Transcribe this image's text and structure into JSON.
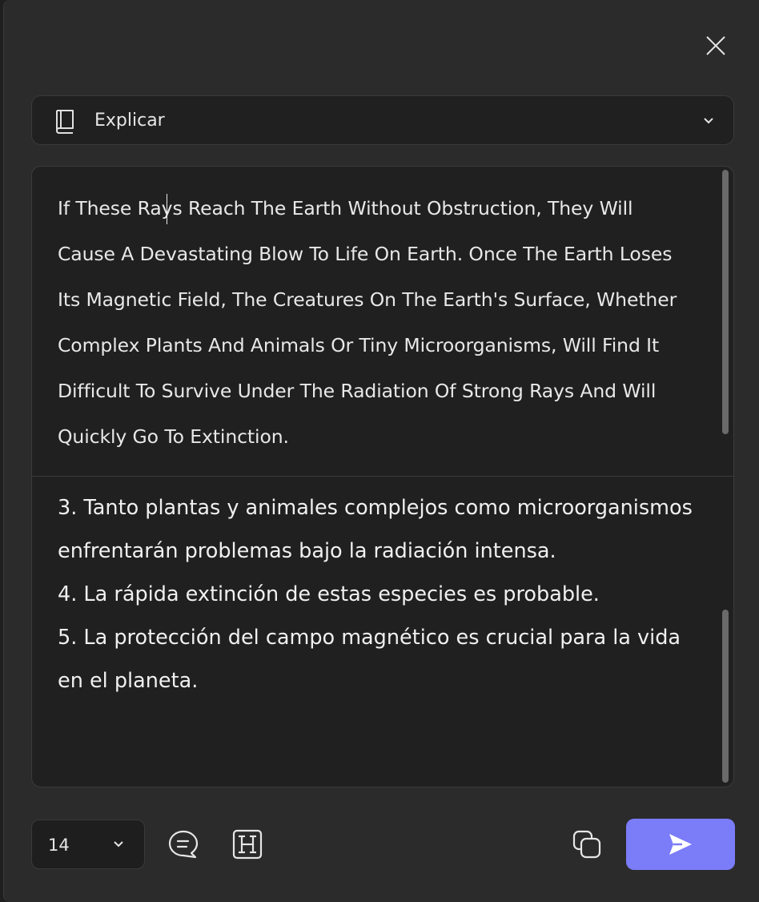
{
  "header": {
    "close_icon": "close-icon"
  },
  "mode_dropdown": {
    "icon": "book-icon",
    "selected": "Explicar"
  },
  "source_text": "If These Rays Reach The Earth Without Obstruction, They Will Cause A Devastating Blow To Life On Earth. Once The Earth Loses Its Magnetic Field, The Creatures On The Earth's Surface, Whether Complex Plants And Animals Or Tiny Microorganisms, Will Find It Difficult To Survive Under The Radiation Of Strong Rays And Will Quickly Go To Extinction.",
  "result_lines": [
    "3. Tanto plantas y animales complejos como microorganismos enfrentarán problemas bajo la radiación intensa.",
    "4. La rápida extinción de estas especies es probable.",
    "5. La protección del campo magnético es crucial para la vida en el planeta."
  ],
  "toolbar": {
    "font_size": "14",
    "chat_icon": "chat-bubble-icon",
    "heading_icon": "heading-icon",
    "copy_icon": "copy-icon",
    "send_icon": "send-icon"
  },
  "colors": {
    "background": "#2b2b2b",
    "panel": "#202020",
    "accent": "#7b7cf8"
  }
}
